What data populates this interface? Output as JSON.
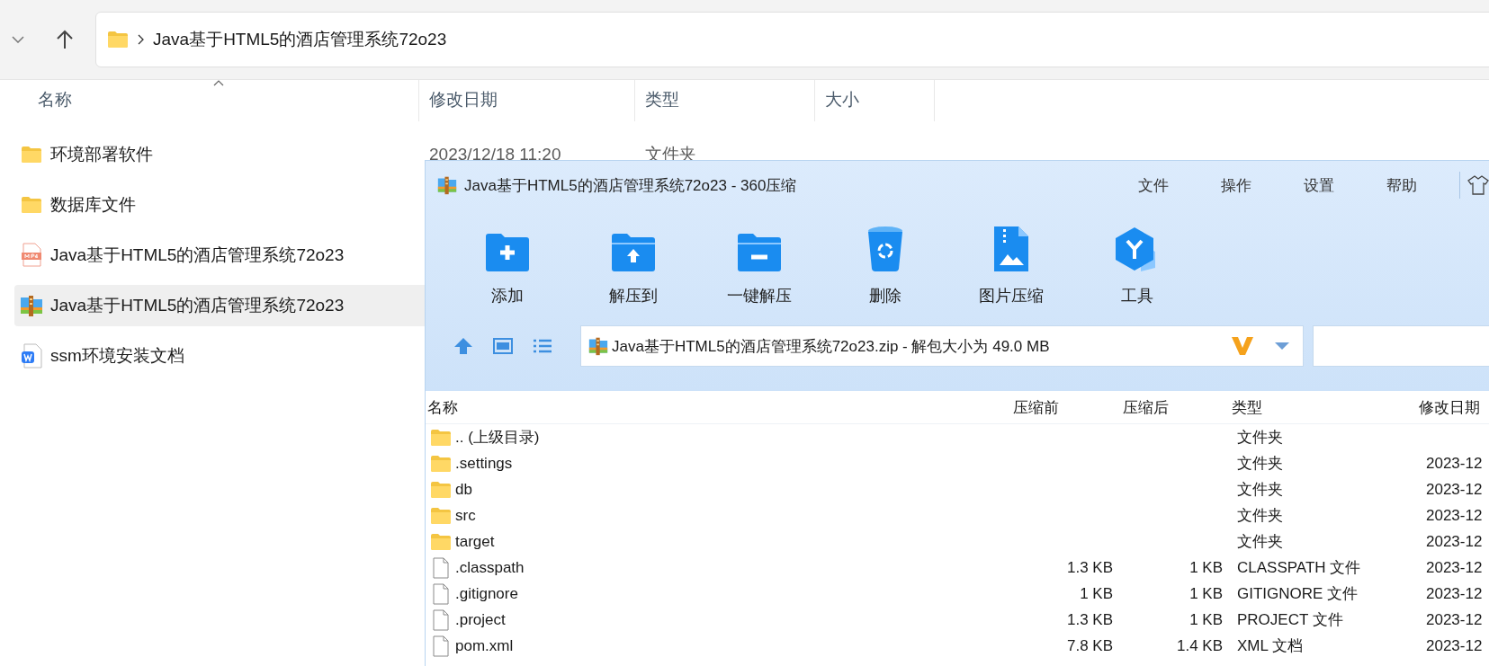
{
  "explorer": {
    "breadcrumb": "Java基于HTML5的酒店管理系统72o23",
    "columns": [
      {
        "label": "名称",
        "sorted": true
      },
      {
        "label": "修改日期",
        "sorted": false
      },
      {
        "label": "类型",
        "sorted": false
      },
      {
        "label": "大小",
        "sorted": false
      }
    ],
    "rows": [
      {
        "kind": "folder",
        "name": "环境部署软件",
        "modified": "2023/12/18 11:20",
        "type": "文件夹",
        "selected": false
      },
      {
        "kind": "folder",
        "name": "数据库文件",
        "selected": false
      },
      {
        "kind": "video",
        "name": "Java基于HTML5的酒店管理系统72o23",
        "selected": false
      },
      {
        "kind": "archive",
        "name": "Java基于HTML5的酒店管理系统72o23",
        "selected": true
      },
      {
        "kind": "document",
        "name": "ssm环境安装文档",
        "selected": false
      }
    ]
  },
  "zip_window": {
    "title": "Java基于HTML5的酒店管理系统72o23 - 360压缩",
    "menu": [
      "文件",
      "操作",
      "设置",
      "帮助"
    ],
    "tools": [
      {
        "kind": "add",
        "label": "添加"
      },
      {
        "kind": "extract",
        "label": "解压到"
      },
      {
        "kind": "quick",
        "label": "一键解压"
      },
      {
        "kind": "delete",
        "label": "删除"
      },
      {
        "kind": "image",
        "label": "图片压缩"
      },
      {
        "kind": "tools",
        "label": "工具"
      }
    ],
    "path": "Java基于HTML5的酒店管理系统72o23.zip - 解包大小为 49.0 MB",
    "columns": [
      "名称",
      "压缩前",
      "压缩后",
      "类型",
      "修改日期"
    ],
    "rows": [
      {
        "kind": "folder",
        "name": ".. (上级目录)",
        "type": "文件夹"
      },
      {
        "kind": "folder",
        "name": ".settings",
        "type": "文件夹",
        "modified": "2023-12"
      },
      {
        "kind": "folder",
        "name": "db",
        "type": "文件夹",
        "modified": "2023-12"
      },
      {
        "kind": "folder",
        "name": "src",
        "type": "文件夹",
        "modified": "2023-12"
      },
      {
        "kind": "folder",
        "name": "target",
        "type": "文件夹",
        "modified": "2023-12"
      },
      {
        "kind": "file",
        "name": ".classpath",
        "original": "1.3 KB",
        "compressed": "1 KB",
        "type": "CLASSPATH 文件",
        "modified": "2023-12"
      },
      {
        "kind": "file",
        "name": ".gitignore",
        "original": "1 KB",
        "compressed": "1 KB",
        "type": "GITIGNORE 文件",
        "modified": "2023-12"
      },
      {
        "kind": "file",
        "name": ".project",
        "original": "1.3 KB",
        "compressed": "1 KB",
        "type": "PROJECT 文件",
        "modified": "2023-12"
      },
      {
        "kind": "file",
        "name": "pom.xml",
        "original": "7.8 KB",
        "compressed": "1.4 KB",
        "type": "XML 文档",
        "modified": "2023-12"
      }
    ]
  }
}
